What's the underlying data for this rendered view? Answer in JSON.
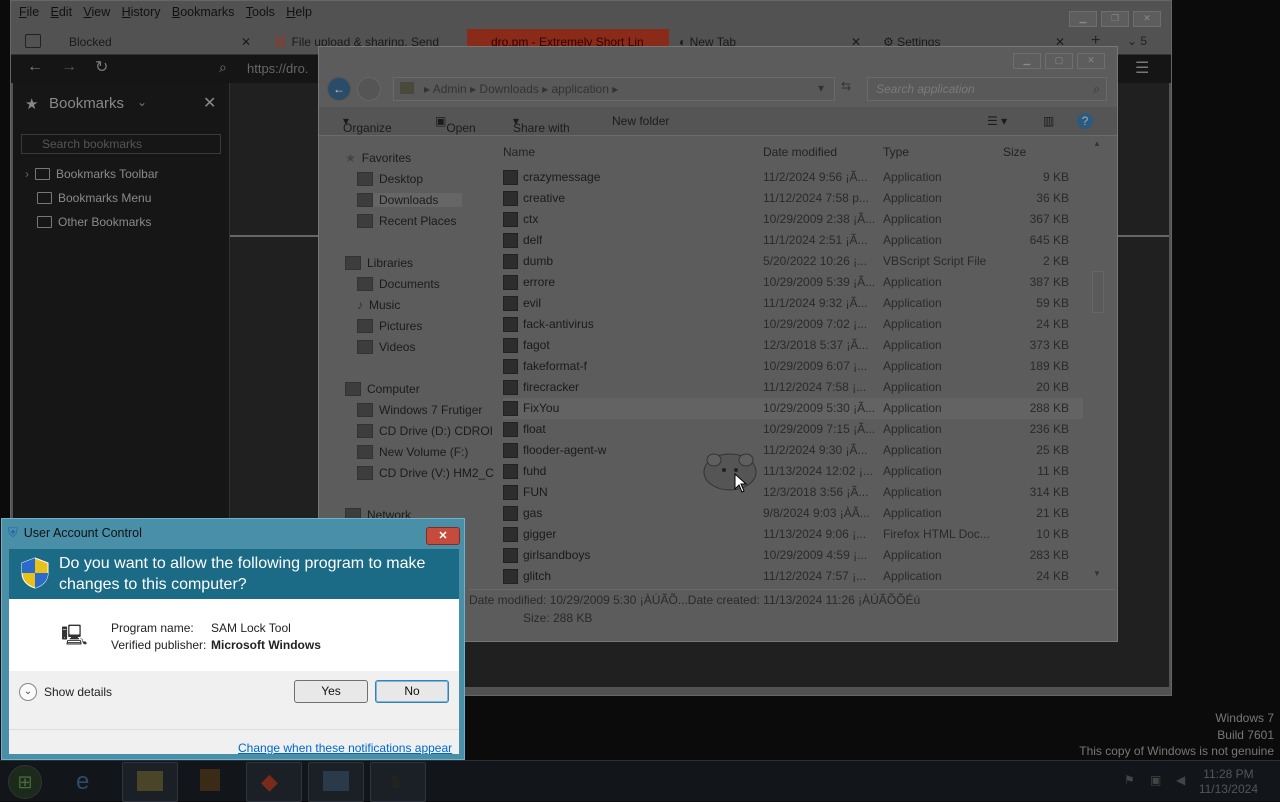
{
  "firefox": {
    "menu": [
      "File",
      "Edit",
      "View",
      "History",
      "Bookmarks",
      "Tools",
      "Help"
    ],
    "tabs": [
      {
        "label": "Blocked"
      },
      {
        "label": "File upload & sharing. Send"
      },
      {
        "label": "dro.pm - Extremely Short Lin"
      },
      {
        "label": "New Tab"
      },
      {
        "label": "Settings"
      }
    ],
    "tab_count": "5",
    "url": "https://dro.",
    "sidebar": {
      "title": "Bookmarks",
      "search_placeholder": "Search bookmarks",
      "items": [
        "Bookmarks Toolbar",
        "Bookmarks Menu",
        "Other Bookmarks"
      ]
    }
  },
  "explorer": {
    "breadcrumb": [
      "Admin",
      "Downloads",
      "application"
    ],
    "search_placeholder": "Search application",
    "commands": {
      "organize": "Organize",
      "open": "Open",
      "share": "Share with",
      "new_folder": "New folder"
    },
    "nav": {
      "favorites": "Favorites",
      "desktop": "Desktop",
      "downloads": "Downloads",
      "recent": "Recent Places",
      "libraries": "Libraries",
      "documents": "Documents",
      "music": "Music",
      "pictures": "Pictures",
      "videos": "Videos",
      "computer": "Computer",
      "c_drive": "Windows 7 Frutiger",
      "d_drive": "CD Drive (D:) CDROI",
      "f_drive": "New Volume (F:)",
      "v_drive": "CD Drive (V:) HM2_C",
      "network": "Network"
    },
    "columns": {
      "name": "Name",
      "date": "Date modified",
      "type": "Type",
      "size": "Size"
    },
    "files": [
      {
        "name": "crazymessage",
        "date": "11/2/2024 9:56 ¡Ã...",
        "type": "Application",
        "size": "9 KB"
      },
      {
        "name": "creative",
        "date": "11/12/2024 7:58 p...",
        "type": "Application",
        "size": "36 KB"
      },
      {
        "name": "ctx",
        "date": "10/29/2009 2:38 ¡Ã...",
        "type": "Application",
        "size": "367 KB"
      },
      {
        "name": "delf",
        "date": "11/1/2024 2:51 ¡Ã...",
        "type": "Application",
        "size": "645 KB"
      },
      {
        "name": "dumb",
        "date": "5/20/2022 10:26 ¡...",
        "type": "VBScript Script File",
        "size": "2 KB"
      },
      {
        "name": "errore",
        "date": "10/29/2009 5:39 ¡Ã...",
        "type": "Application",
        "size": "387 KB"
      },
      {
        "name": "evil",
        "date": "11/1/2024 9:32 ¡Ã...",
        "type": "Application",
        "size": "59 KB"
      },
      {
        "name": "fack-antivirus",
        "date": "10/29/2009 7:02 ¡...",
        "type": "Application",
        "size": "24 KB"
      },
      {
        "name": "fagot",
        "date": "12/3/2018 5:37 ¡Ã...",
        "type": "Application",
        "size": "373 KB"
      },
      {
        "name": "fakeformat-f",
        "date": "10/29/2009 6:07 ¡...",
        "type": "Application",
        "size": "189 KB"
      },
      {
        "name": "firecracker",
        "date": "11/12/2024 7:58 ¡...",
        "type": "Application",
        "size": "20 KB"
      },
      {
        "name": "FixYou",
        "date": "10/29/2009 5:30 ¡Ã...",
        "type": "Application",
        "size": "288 KB"
      },
      {
        "name": "float",
        "date": "10/29/2009 7:15 ¡Ã...",
        "type": "Application",
        "size": "236 KB"
      },
      {
        "name": "flooder-agent-w",
        "date": "11/2/2024 9:30 ¡Ã...",
        "type": "Application",
        "size": "25 KB"
      },
      {
        "name": "fuhd",
        "date": "11/13/2024 12:02 ¡...",
        "type": "Application",
        "size": "11 KB"
      },
      {
        "name": "FUN",
        "date": "12/3/2018 3:56 ¡Ã...",
        "type": "Application",
        "size": "314 KB"
      },
      {
        "name": "gas",
        "date": "9/8/2024 9:03 ¡ÀÃ...",
        "type": "Application",
        "size": "21 KB"
      },
      {
        "name": "gigger",
        "date": "11/13/2024 9:06 ¡...",
        "type": "Firefox HTML Doc...",
        "size": "10 KB"
      },
      {
        "name": "girlsandboys",
        "date": "10/29/2009 4:59 ¡...",
        "type": "Application",
        "size": "283 KB"
      },
      {
        "name": "glitch",
        "date": "11/12/2024 7:57 ¡...",
        "type": "Application",
        "size": "24 KB"
      }
    ],
    "details": {
      "line1": "Date modified: 10/29/2009 5:30 ¡ÀÚÃÕ...Date created: 11/13/2024 11:26 ¡ÀÚÃÕÕÉú",
      "line2": "Size: 288 KB"
    }
  },
  "uac": {
    "title": "User Account Control",
    "question": "Do you want to allow the following program to make changes to this computer?",
    "program_label": "Program name:",
    "program_value": "SAM Lock Tool",
    "publisher_label": "Verified publisher:",
    "publisher_value": "Microsoft Windows",
    "show_details": "Show details",
    "yes": "Yes",
    "no": "No",
    "link": "Change when these notifications appear"
  },
  "desktop": {
    "watermark": [
      "Windows 7",
      "Build 7601",
      "This copy of Windows is not genuine"
    ]
  },
  "taskbar": {
    "time": "11:28 PM",
    "date": "11/13/2024"
  }
}
